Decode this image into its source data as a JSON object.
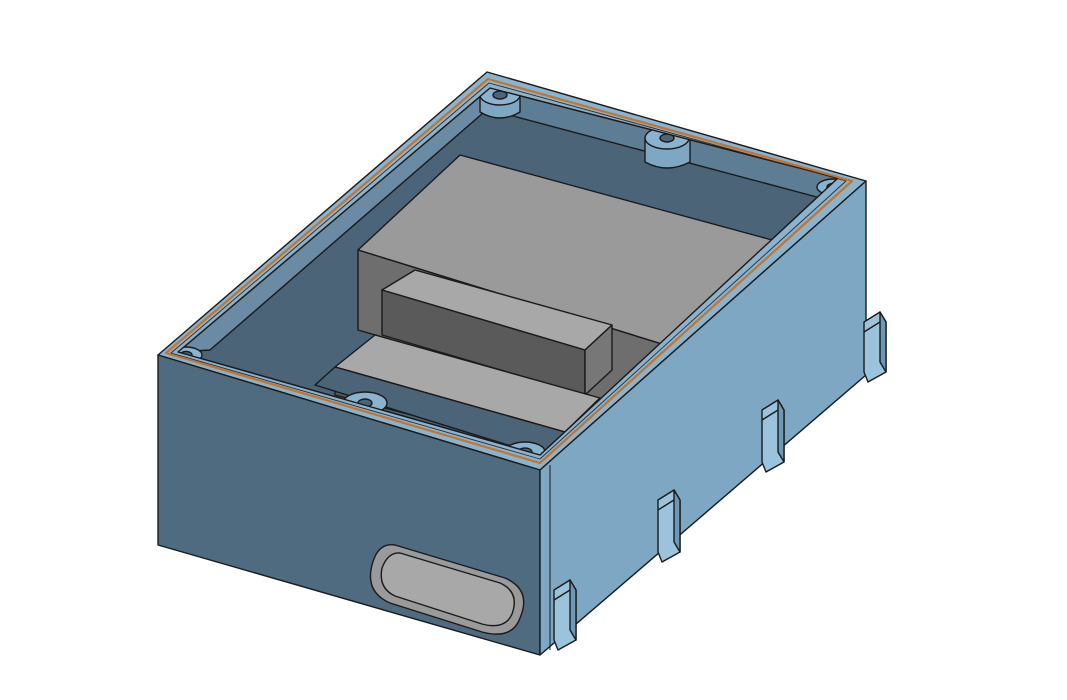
{
  "viewport": {
    "background": "#ffffff",
    "model": "enclosure-box-3d-render"
  },
  "colors": {
    "box_outer_light": "#7ea7c4",
    "box_outer_mid": "#6e97b5",
    "box_front_dark": "#4f6b80",
    "box_inner_dark": "#4b6477",
    "box_inner_wall": "#5f8098",
    "rim_top": "#8ab3d0",
    "gasket": "#c4742b",
    "edge": "#1a1a1a",
    "component_top": "#9a9a9a",
    "component_side": "#6e6e6e",
    "component_dark": "#5a5a5a",
    "component_light": "#a8a8a8",
    "port_outer": "#8f8f8f",
    "port_inner": "#a6a6a6"
  }
}
